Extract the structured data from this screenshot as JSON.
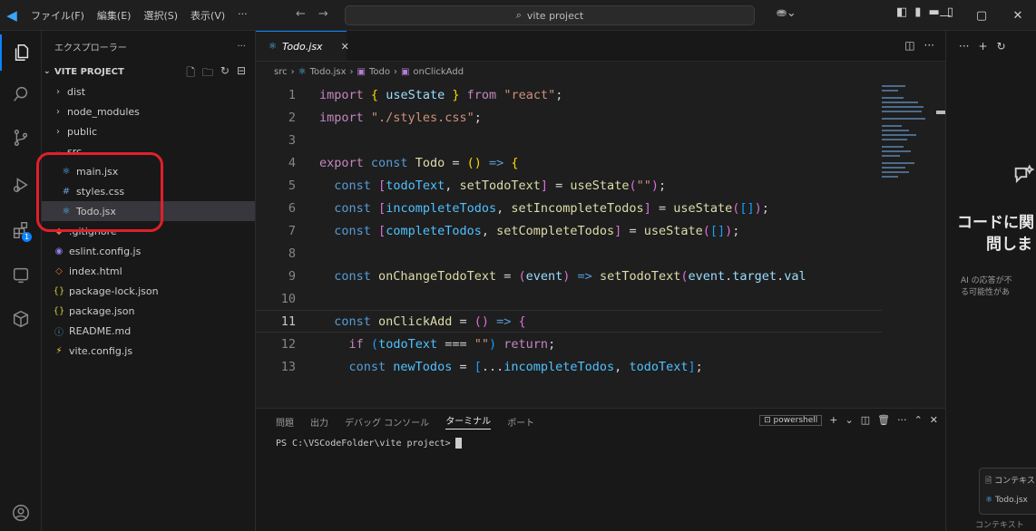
{
  "titlebar": {
    "menu": [
      "ファイル(F)",
      "編集(E)",
      "選択(S)",
      "表示(V)",
      "···"
    ],
    "search_text": "vite project",
    "window_buttons": [
      "—",
      "▢",
      "✕"
    ]
  },
  "activity": {
    "extensions_badge": "1"
  },
  "sidebar": {
    "header": "エクスプローラー",
    "header_more": "···",
    "project": "VITE PROJECT",
    "items": [
      {
        "label": "dist",
        "type": "folder",
        "open": false,
        "depth": 1
      },
      {
        "label": "node_modules",
        "type": "folder",
        "open": false,
        "depth": 1
      },
      {
        "label": "public",
        "type": "folder",
        "open": false,
        "depth": 1
      },
      {
        "label": "src",
        "type": "folder",
        "open": true,
        "depth": 1
      },
      {
        "label": "main.jsx",
        "type": "jsx",
        "depth": 2
      },
      {
        "label": "styles.css",
        "type": "css",
        "depth": 2
      },
      {
        "label": "Todo.jsx",
        "type": "jsx",
        "depth": 2,
        "selected": true
      },
      {
        "label": ".gitignore",
        "type": "git",
        "depth": 1
      },
      {
        "label": "eslint.config.js",
        "type": "eslint",
        "depth": 1
      },
      {
        "label": "index.html",
        "type": "html",
        "depth": 1
      },
      {
        "label": "package-lock.json",
        "type": "json",
        "depth": 1
      },
      {
        "label": "package.json",
        "type": "json",
        "depth": 1
      },
      {
        "label": "README.md",
        "type": "md",
        "depth": 1
      },
      {
        "label": "vite.config.js",
        "type": "vite",
        "depth": 1
      }
    ]
  },
  "editor": {
    "tab_label": "Todo.jsx",
    "breadcrumb": [
      "src",
      "Todo.jsx",
      "Todo",
      "onClickAdd"
    ],
    "line_numbers": [
      "1",
      "2",
      "3",
      "4",
      "5",
      "6",
      "7",
      "8",
      "9",
      "10",
      "11",
      "12",
      "13"
    ],
    "current_line": "11"
  },
  "panel": {
    "tabs": [
      "問題",
      "出力",
      "デバッグ コンソール",
      "ターミナル",
      "ポート"
    ],
    "active_tab": "ターミナル",
    "shell": "powershell",
    "prompt": "PS C:\\VSCodeFolder\\vite project>"
  },
  "chat": {
    "title_line1": "コードに関",
    "title_line2": "問しま",
    "note_line1": "AI の応答が不",
    "note_line2": "る可能性があ",
    "chip_context": "コンテキスト",
    "chip_file": "Todo.jsx",
    "footer": "コンテキスト"
  }
}
